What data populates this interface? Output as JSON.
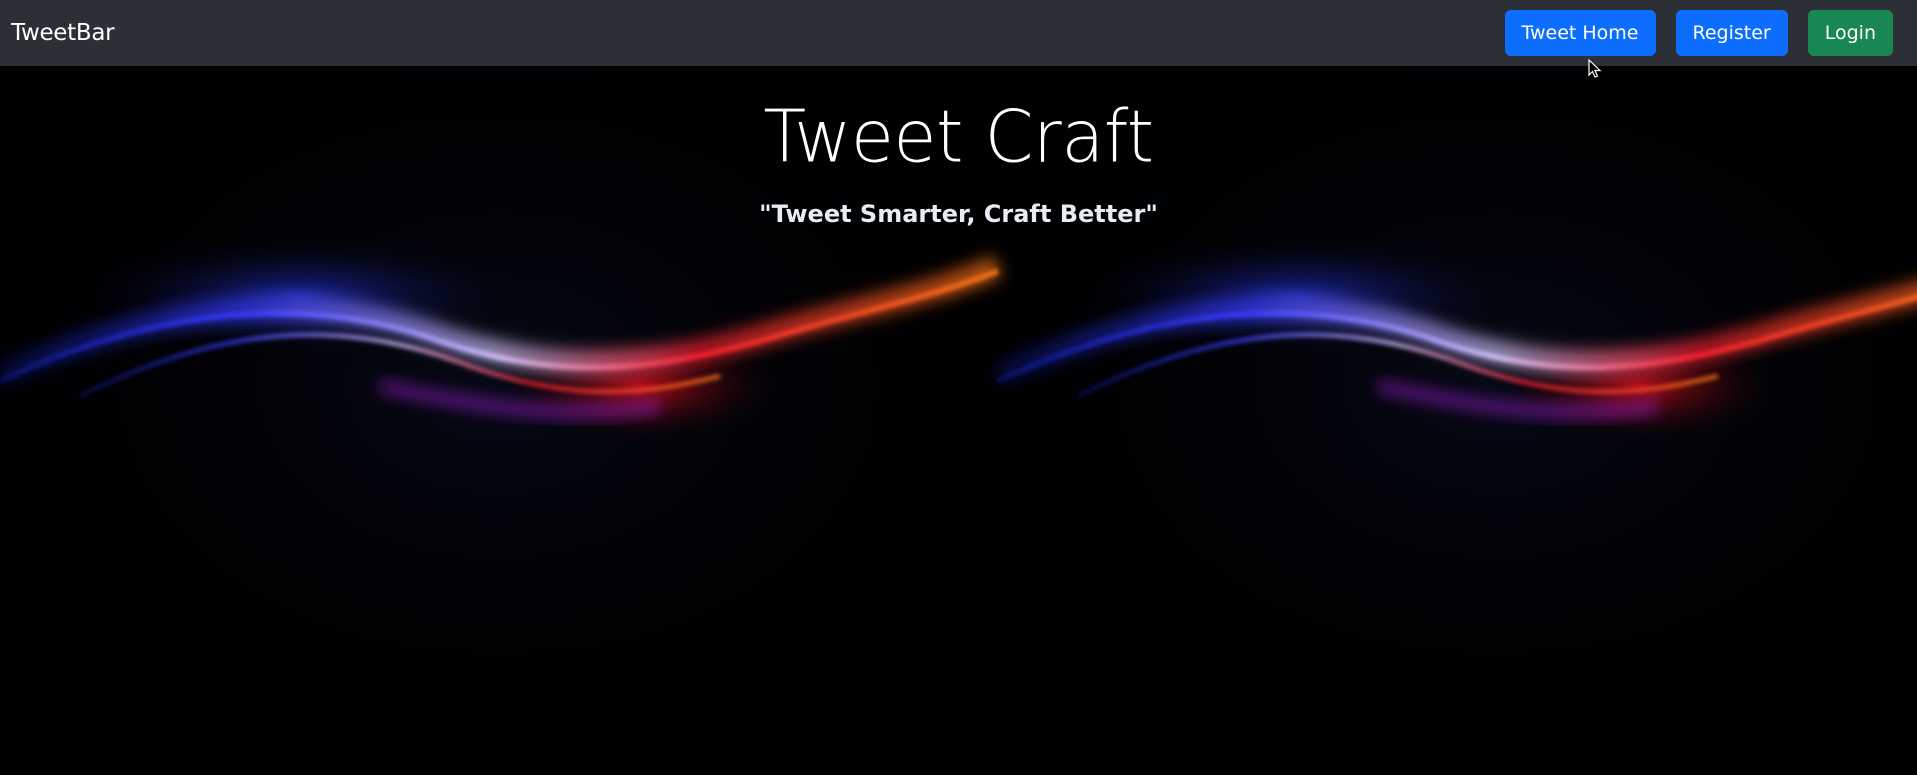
{
  "navbar": {
    "brand": "TweetBar",
    "buttons": {
      "tweet_home": "Tweet Home",
      "register": "Register",
      "login": "Login"
    }
  },
  "hero": {
    "title": "Tweet Craft",
    "subtitle": "\"Tweet Smarter, Craft Better\""
  },
  "colors": {
    "navbar_bg": "#2c2f35",
    "primary": "#0d6efd",
    "success": "#198754",
    "hero_bg": "#000000"
  },
  "icons": {
    "cursor": "mouse-pointer-icon"
  }
}
